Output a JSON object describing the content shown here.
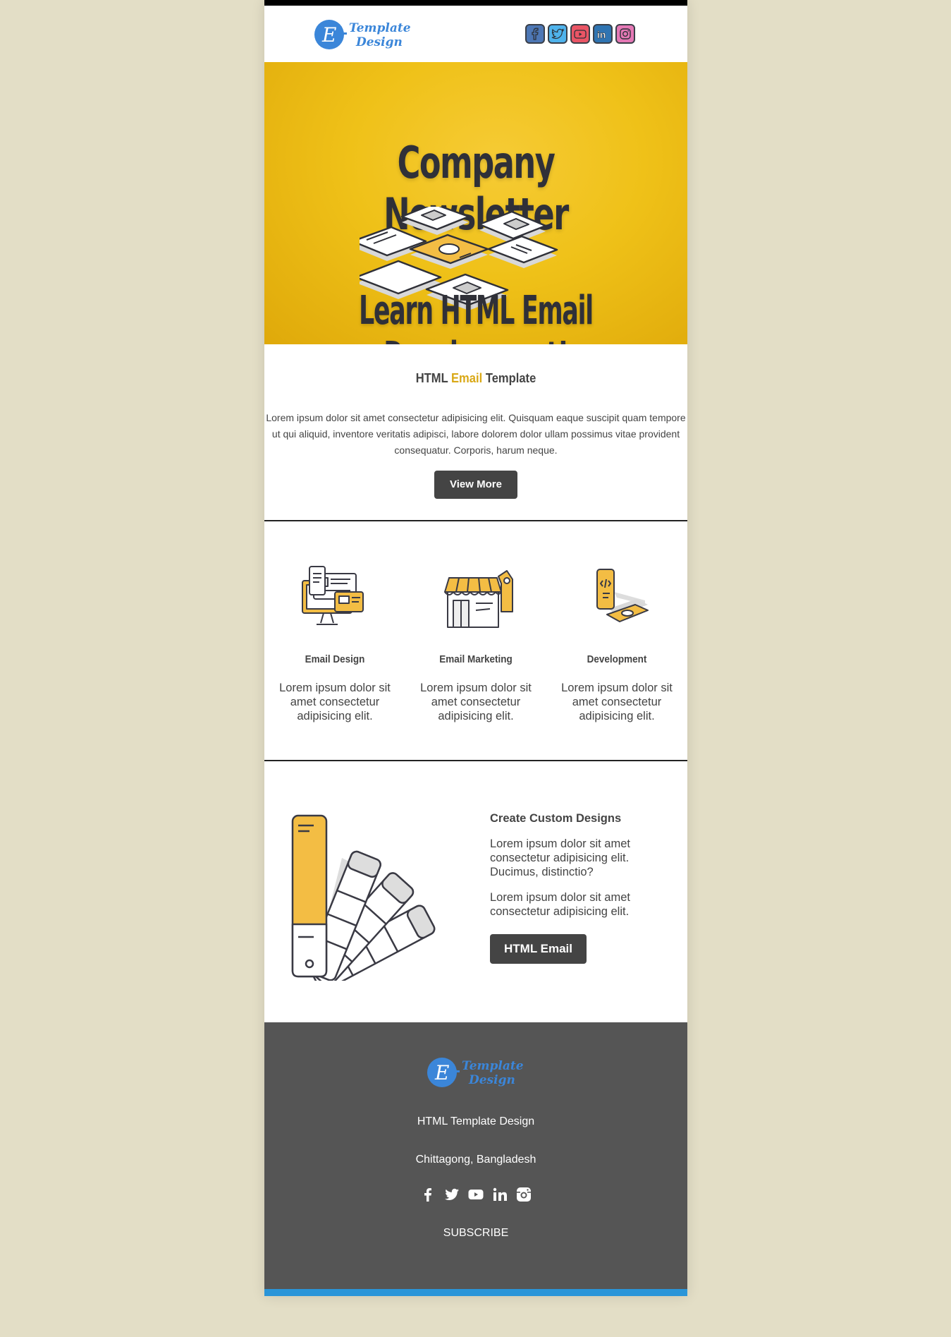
{
  "brand": {
    "logo_line1": "Template",
    "logo_line2": "Design",
    "logo_letter": "E"
  },
  "header": {
    "social_icons": [
      "facebook-icon",
      "twitter-icon",
      "youtube-icon",
      "linkedin-icon",
      "instagram-icon"
    ]
  },
  "hero": {
    "title": "Company Newsletter",
    "subtitle": "Learn HTML Email Development!"
  },
  "intro": {
    "title_part1": "HTML",
    "title_accent": "Email",
    "title_part2": "Template",
    "body": "Lorem ipsum dolor sit amet consectetur adipisicing elit. Quisquam eaque suscipit quam tempore ut qui aliquid, inventore veritatis adipisci, labore dolorem dolor ullam possimus vitae provident consequatur. Corporis, harum neque.",
    "button_label": "View More"
  },
  "features": [
    {
      "title": "Email Design",
      "text": "Lorem ipsum dolor sit amet consectetur adipisicing elit.",
      "icon": "devices-icon"
    },
    {
      "title": "Email Marketing",
      "text": "Lorem ipsum dolor sit amet consectetur adipisicing elit.",
      "icon": "storefront-icon"
    },
    {
      "title": "Development",
      "text": "Lorem ipsum dolor sit amet consectetur adipisicing elit.",
      "icon": "phone-code-icon"
    }
  ],
  "custom": {
    "title": "Create Custom Designs",
    "para1": "Lorem ipsum dolor sit amet consectetur adipisicing elit. Ducimus, distinctio?",
    "para2": "Lorem ipsum dolor sit amet consectetur adipisicing elit.",
    "button_label": "HTML Email"
  },
  "footer": {
    "company": "HTML Template Design",
    "location": "Chittagong, Bangladesh",
    "subscribe": "SUBSCRIBE",
    "social_icons": [
      "facebook-icon",
      "twitter-icon",
      "youtube-icon",
      "linkedin-icon",
      "instagram-icon"
    ]
  },
  "colors": {
    "page_bg": "#e3dec6",
    "accent_yellow": "#f3bd44",
    "button_bg": "#444444",
    "footer_bg": "#555555",
    "footer_bar": "#2a95d8",
    "logo_blue": "#3b86d9"
  }
}
